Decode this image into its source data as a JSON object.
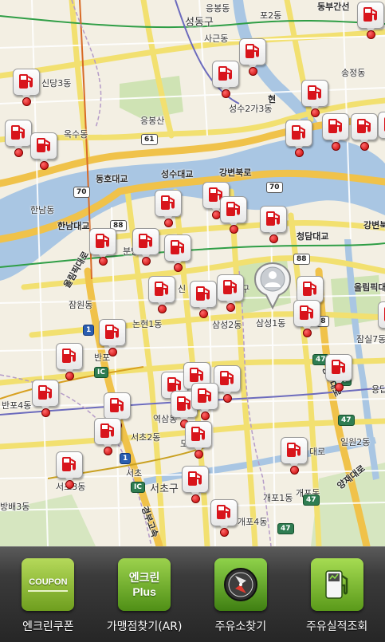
{
  "map": {
    "district_labels": [
      {
        "id": "seongdong",
        "text": "성동구"
      },
      {
        "id": "eungbong",
        "text": "응봉동"
      },
      {
        "id": "sageun",
        "text": "사근동"
      },
      {
        "id": "songjeong",
        "text": "송정동"
      },
      {
        "id": "sindang3",
        "text": "신당3동"
      },
      {
        "id": "eungbongsan",
        "text": "응봉산"
      },
      {
        "id": "seongsu2ga3",
        "text": "성수2가3동"
      },
      {
        "id": "oksu",
        "text": "옥수동"
      },
      {
        "id": "dongho",
        "text": "동호대교"
      },
      {
        "id": "seongsu_bridge",
        "text": "성수대교"
      },
      {
        "id": "gangbyeon_n",
        "text": "강변북로"
      },
      {
        "id": "hannam",
        "text": "한남동"
      },
      {
        "id": "hannam_bridge",
        "text": "한남대교"
      },
      {
        "id": "cheongdam_bridge",
        "text": "청담대교"
      },
      {
        "id": "gangbyeon_e",
        "text": "강변북"
      },
      {
        "id": "olympic_w",
        "text": "올림픽대로"
      },
      {
        "id": "olympic_e",
        "text": "올림픽대"
      },
      {
        "id": "jamwon",
        "text": "잠원동"
      },
      {
        "id": "nonhyeon1",
        "text": "논현1동"
      },
      {
        "id": "samseong2",
        "text": "삼성2동"
      },
      {
        "id": "samseong1",
        "text": "삼성1동"
      },
      {
        "id": "jamsil7",
        "text": "잠실7동"
      },
      {
        "id": "banpo",
        "text": "반포"
      },
      {
        "id": "banpo4",
        "text": "반포4동"
      },
      {
        "id": "yeoksam",
        "text": "역삼동"
      },
      {
        "id": "seocho2",
        "text": "서초2동"
      },
      {
        "id": "ilwon2",
        "text": "일원2동"
      },
      {
        "id": "gaepo",
        "text": "개포동"
      },
      {
        "id": "seocho",
        "text": "서초"
      },
      {
        "id": "seochogu",
        "text": "서초구"
      },
      {
        "id": "gaepo1",
        "text": "개포1동"
      },
      {
        "id": "gaepo4",
        "text": "개포4동"
      },
      {
        "id": "bangbae3",
        "text": "방배3동"
      },
      {
        "id": "seocho3",
        "text": "서초3동"
      },
      {
        "id": "dongbu",
        "text": "동부간선"
      },
      {
        "id": "yangjae",
        "text": "양재대로"
      },
      {
        "id": "yeongdong",
        "text": "영동대로"
      },
      {
        "id": "gyeongbu",
        "text": "경부고속"
      },
      {
        "id": "eungdap",
        "text": "용답동"
      },
      {
        "id": "bundang",
        "text": "분당"
      },
      {
        "id": "shin",
        "text": "신"
      },
      {
        "id": "hyeon",
        "text": "현"
      },
      {
        "id": "do",
        "text": "도"
      },
      {
        "id": "gu",
        "text": "구"
      },
      {
        "id": "po",
        "text": "포2동"
      },
      {
        "id": "daero",
        "text": "대로"
      }
    ],
    "route_shields": [
      "61",
      "70",
      "88",
      "88",
      "70",
      "88",
      "1",
      "IC",
      "47",
      "47",
      "1",
      "IC",
      "47",
      "47",
      "47"
    ],
    "station_count": 50
  },
  "user_location": {
    "icon": "person-icon"
  },
  "toolbar": {
    "items": [
      {
        "id": "coupon",
        "label": "엔크린쿠폰",
        "icon_text": "COUPON"
      },
      {
        "id": "store",
        "label": "가맹점찾기(AR)",
        "icon_text_1": "엔크린",
        "icon_text_2": "Plus"
      },
      {
        "id": "station",
        "label": "주유소찾기",
        "icon": "compass-icon"
      },
      {
        "id": "record",
        "label": "주유실적조회",
        "icon": "fuel-pump-icon"
      }
    ]
  },
  "colors": {
    "map_bg": "#f4f1e6",
    "water": "#a9c6e3",
    "road_major": "#f2e56e",
    "road_highway": "#f0c24a",
    "pin_red": "#d8141b",
    "toolbar_bg": "#333333",
    "icon_green": "#7fbf33"
  }
}
